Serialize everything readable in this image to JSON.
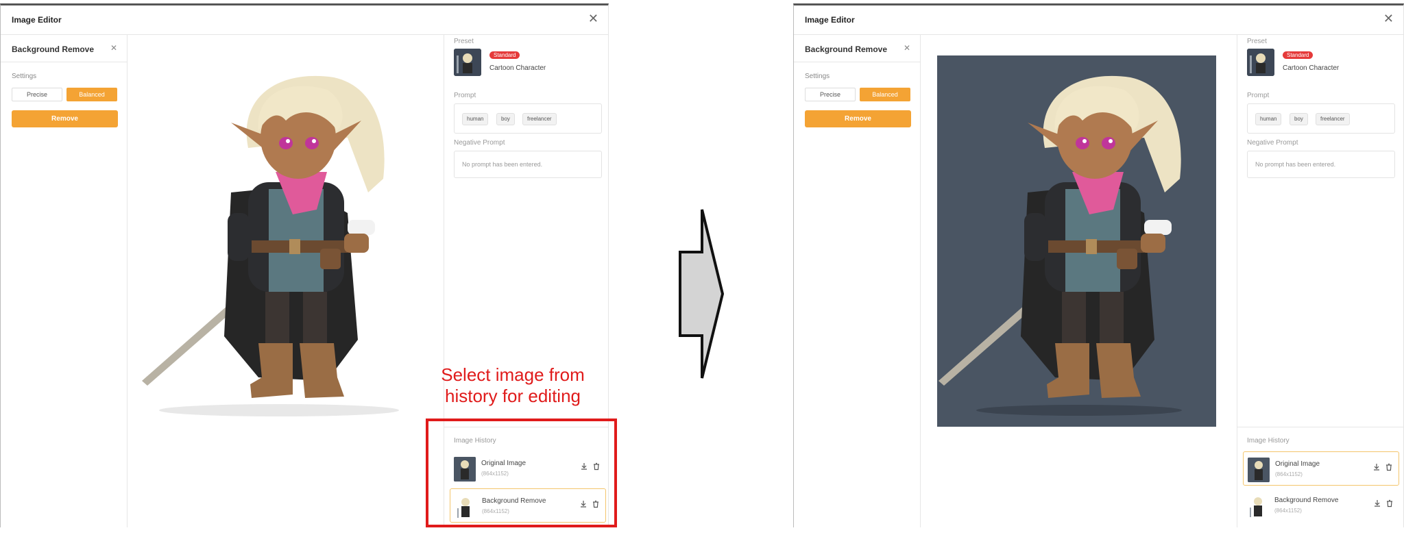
{
  "left": {
    "window_title": "Image Editor",
    "sidebar": {
      "title": "Background Remove",
      "settings_label": "Settings",
      "modes": [
        "Precise",
        "Balanced"
      ],
      "selected_mode": "Balanced",
      "action_label": "Remove"
    },
    "panel": {
      "preset_label": "Preset",
      "preset_badge": "Standard",
      "preset_name": "Cartoon Character",
      "prompt_label": "Prompt",
      "prompt_tags": [
        "human",
        "boy",
        "freelancer"
      ],
      "negative_label": "Negative Prompt",
      "negative_placeholder": "No prompt has been entered.",
      "history_label": "Image History",
      "history": [
        {
          "name": "Original Image",
          "size": "(864x1152)"
        },
        {
          "name": "Background Remove",
          "size": "(864x1152)"
        }
      ],
      "selected_history": "Background Remove"
    },
    "annotation": "Select image from history for editing"
  },
  "right": {
    "window_title": "Image Editor",
    "sidebar": {
      "title": "Background Remove",
      "settings_label": "Settings",
      "modes": [
        "Precise",
        "Balanced"
      ],
      "selected_mode": "Balanced",
      "action_label": "Remove"
    },
    "panel": {
      "preset_label": "Preset",
      "preset_badge": "Standard",
      "preset_name": "Cartoon Character",
      "prompt_label": "Prompt",
      "prompt_tags": [
        "human",
        "boy",
        "freelancer"
      ],
      "negative_label": "Negative Prompt",
      "negative_placeholder": "No prompt has been entered.",
      "history_label": "Image History",
      "history": [
        {
          "name": "Original Image",
          "size": "(864x1152)"
        },
        {
          "name": "Background Remove",
          "size": "(864x1152)"
        }
      ],
      "selected_history": "Original Image"
    }
  },
  "colors": {
    "accent": "#f4a334",
    "badge": "#e53a3a",
    "annotation": "#e01b1b",
    "original_background": "#4a5563"
  },
  "icons": [
    "close-icon",
    "download-icon",
    "trash-icon",
    "right-arrow-icon"
  ]
}
